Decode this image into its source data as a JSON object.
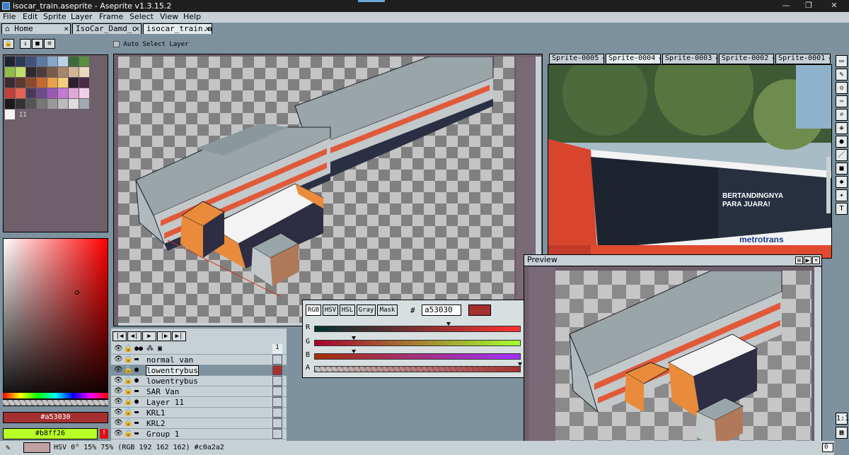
{
  "window": {
    "title": "isocar_train.aseprite - Aseprite v1.3.15.2",
    "controls": [
      "—",
      "❐",
      "✕"
    ]
  },
  "menu": [
    "File",
    "Edit",
    "Sprite",
    "Layer",
    "Frame",
    "Select",
    "View",
    "Help"
  ],
  "tabs": [
    {
      "label": "Home",
      "close": "✕"
    },
    {
      "label": "IsoCar_Damd_c",
      "close": "✕"
    },
    {
      "label": "isocar_train.as",
      "close": "✕"
    }
  ],
  "context_bar": {
    "auto_select_label": "Auto Select Layer"
  },
  "palette": {
    "swatches": [
      "#1d2431",
      "#2c3b55",
      "#3e5377",
      "#5a7aa2",
      "#86a7c9",
      "#b9d2e3",
      "#3c6b3a",
      "#5a8f3e",
      "#8fbd4a",
      "#c0dc6c",
      "#2b2a2f",
      "#4b3d3b",
      "#7a5a4a",
      "#a8866a",
      "#d2b693",
      "#e9d9bc",
      "#3b2a2e",
      "#5c3a30",
      "#8b4a2e",
      "#c46a30",
      "#e8a04a",
      "#f2cf7a",
      "#2d1f2e",
      "#4a2a44",
      "#c0403a",
      "#e26450",
      "#4a3a5a",
      "#6d4a8a",
      "#9a5ab4",
      "#c47ad0",
      "#e0a8d8",
      "#f0d0e8",
      "#1a1a1a",
      "#333333",
      "#555555",
      "#777777",
      "#999999",
      "#bbbbbb",
      "#dddddd",
      "#a0aab0",
      "#f4f4f4"
    ],
    "extra_label": "II"
  },
  "colors": {
    "foreground": "#a53030",
    "background": "#b8ff26",
    "foreground_label": "#a53030",
    "background_label": "#b8ff26",
    "warning": "!"
  },
  "timeline": {
    "controls": [
      "|◀",
      "◀|",
      "▶",
      "|▶",
      "▶|"
    ],
    "frame_number": "1",
    "layers": [
      {
        "name": "normal van",
        "kind": "group",
        "selected": false
      },
      {
        "name": "lowentrybus",
        "kind": "layer",
        "selected": true
      },
      {
        "name": "lowentrybus",
        "kind": "layer",
        "selected": false
      },
      {
        "name": "SAR Van",
        "kind": "group",
        "selected": false
      },
      {
        "name": "Layer 11",
        "kind": "layer",
        "selected": false
      },
      {
        "name": "KRL1",
        "kind": "group",
        "selected": false
      },
      {
        "name": "KRL2",
        "kind": "group",
        "selected": false
      },
      {
        "name": "Group 1",
        "kind": "group",
        "selected": false
      }
    ]
  },
  "color_popup": {
    "modes": [
      "RGB",
      "HSV",
      "HSL",
      "Gray",
      "Mask"
    ],
    "hash": "#",
    "hex": "a53030",
    "close": "✕",
    "channels": [
      {
        "label": "R",
        "value": "165",
        "pos": 0.65
      },
      {
        "label": "G",
        "value": "48",
        "pos": 0.19
      },
      {
        "label": "B",
        "value": "48",
        "pos": 0.19
      },
      {
        "label": "A",
        "value": "255",
        "pos": 1.0
      }
    ]
  },
  "sprite_tabs": [
    "Sprite-0005",
    "Sprite-0004",
    "Sprite-0003",
    "Sprite-0002",
    "Sprite-0001"
  ],
  "reference_photo": {
    "bus_text": [
      "BERTANDINGNYA",
      "PARA JUARA!"
    ],
    "brand": "metrotrans"
  },
  "preview": {
    "title": "Preview",
    "buttons": [
      "⊞",
      "▶",
      "✕"
    ]
  },
  "right_tools": {
    "icons": [
      "marquee-icon",
      "pencil-icon",
      "eraser-icon",
      "eyedropper-icon",
      "zoom-icon",
      "move-icon",
      "fill-icon",
      "line-icon",
      "rect-icon",
      "ellipse-icon",
      "blur-icon",
      "text-icon"
    ],
    "zoom_label": "1:1"
  },
  "status": {
    "text": "HSV 0° 15% 75% (RGB 192 162 162) #c0a2a2",
    "swatch": "#c0a2a2",
    "right_value": "0"
  }
}
